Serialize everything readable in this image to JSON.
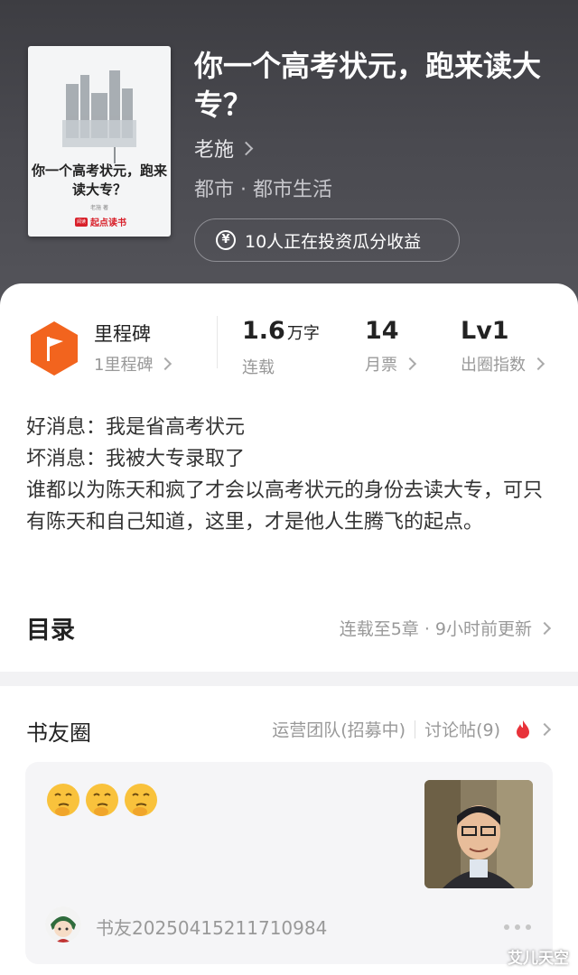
{
  "book": {
    "cover_title": "你一个高考状元，跑来读大专？",
    "cover_author": "老施 著",
    "cover_brand_mark": "阅读",
    "cover_brand": "起点读书",
    "title": "你一个高考状元，跑来读大专？",
    "author": "老施",
    "genre": "都市 · 都市生活",
    "invest_label": "10人正在投资瓜分收益"
  },
  "stats": {
    "milestone_title": "里程碑",
    "milestone_sub": "1里程碑",
    "words_value": "1.6",
    "words_unit": "万字",
    "words_label": "连载",
    "tickets_value": "14",
    "tickets_label": "月票",
    "level_value": "Lv1",
    "level_label": "出圈指数"
  },
  "description": [
    "好消息：我是省高考状元",
    "坏消息：我被大专录取了",
    "谁都以为陈天和疯了才会以高考状元的身份去读大专，可只有陈天和自己知道，这里，才是他人生腾飞的起点。"
  ],
  "toc": {
    "title": "目录",
    "status": "连载至5章 · 9小时前更新"
  },
  "circle": {
    "title": "书友圈",
    "ops_link": "运营团队(招募中)",
    "discuss_link": "讨论帖(9)"
  },
  "post": {
    "emojis": [
      "thinking-face-icon",
      "thinking-face-icon",
      "thinking-face-icon"
    ],
    "username": "书友20250415211710984"
  },
  "watermark": "艾儿天空",
  "colors": {
    "accent_orange": "#f2641e",
    "brand_red": "#d8202a",
    "flame_red": "#e8333a"
  }
}
